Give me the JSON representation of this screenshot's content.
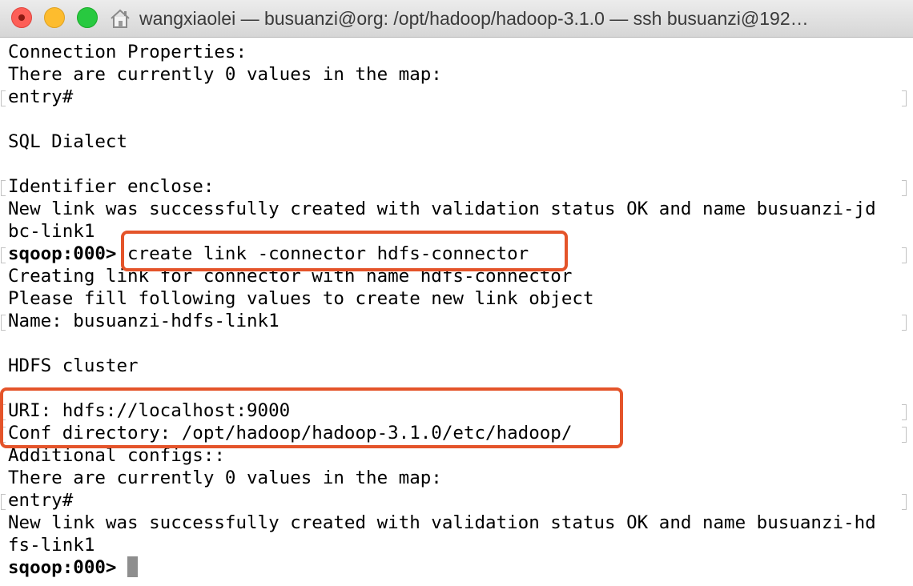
{
  "window": {
    "title": "wangxiaolei — busuanzi@org: /opt/hadoop/hadoop-3.1.0 — ssh busuanzi@192…",
    "title_icon": "home-icon"
  },
  "terminal": {
    "lines": [
      "Connection Properties:",
      "There are currently 0 values in the map:",
      "entry#",
      "",
      "SQL Dialect",
      "",
      "Identifier enclose:",
      "New link was successfully created with validation status OK and name busuanzi-jd",
      "bc-link1",
      "",
      "Creating link for connector with name hdfs-connector",
      "Please fill following values to create new link object",
      "Name: busuanzi-hdfs-link1",
      "",
      "HDFS cluster",
      "",
      "URI: hdfs://localhost:9000",
      "Conf directory: /opt/hadoop/hadoop-3.1.0/etc/hadoop/",
      "Additional configs::",
      "There are currently 0 values in the map:",
      "entry#",
      "New link was successfully created with validation status OK and name busuanzi-hd",
      "fs-link1",
      ""
    ],
    "prompt": "sqoop:000>",
    "command": "create link -connector hdfs-connector"
  },
  "colors": {
    "highlight_box": "#e4542a",
    "close_button": "#fd5f57",
    "minimize_button": "#fdbc2e",
    "zoom_button": "#28c940"
  }
}
